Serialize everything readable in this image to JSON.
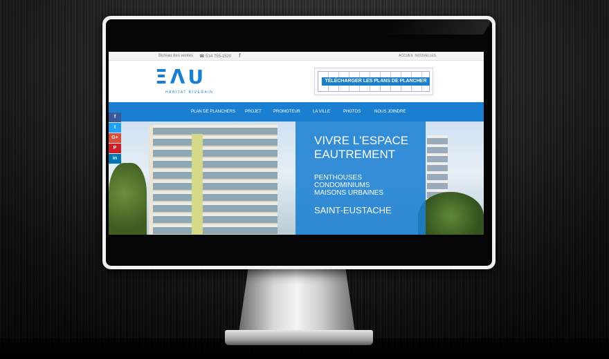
{
  "topbar": {
    "sales_label": "Bureau des ventes",
    "phone": "☎ 514 755-1520",
    "facebook": "f",
    "nav_home": "ACCUEIL",
    "nav_news": "NOUVELLES"
  },
  "logo": {
    "main": "ΞΛU",
    "sub": "HABITAT RIVERAIN"
  },
  "download": {
    "label": "TÉLÉCHARGER LES PLANS DE PLANCHER"
  },
  "nav": [
    "PLAN DE PLANCHERS",
    "PROJET",
    "PROMOTEUR",
    "LA VILLE",
    "PHOTOS",
    "NOUS JOINDRE"
  ],
  "hero": {
    "title_1": "VIVRE L'ESPACE",
    "title_2": "EAUTREMENT",
    "types": [
      "PENTHOUSES",
      "CONDOMINIUMS",
      "MAISONS URBAINES"
    ],
    "city": "SAINT-EUSTACHE"
  },
  "social": [
    {
      "name": "facebook",
      "glyph": "f",
      "color": "#3b5998"
    },
    {
      "name": "twitter",
      "glyph": "t",
      "color": "#1da1f2"
    },
    {
      "name": "google-plus",
      "glyph": "G+",
      "color": "#dd4b39"
    },
    {
      "name": "pinterest",
      "glyph": "P",
      "color": "#cb2027"
    },
    {
      "name": "linkedin",
      "glyph": "in",
      "color": "#0077b5"
    }
  ],
  "colors": {
    "accent": "#1b7fd1"
  }
}
